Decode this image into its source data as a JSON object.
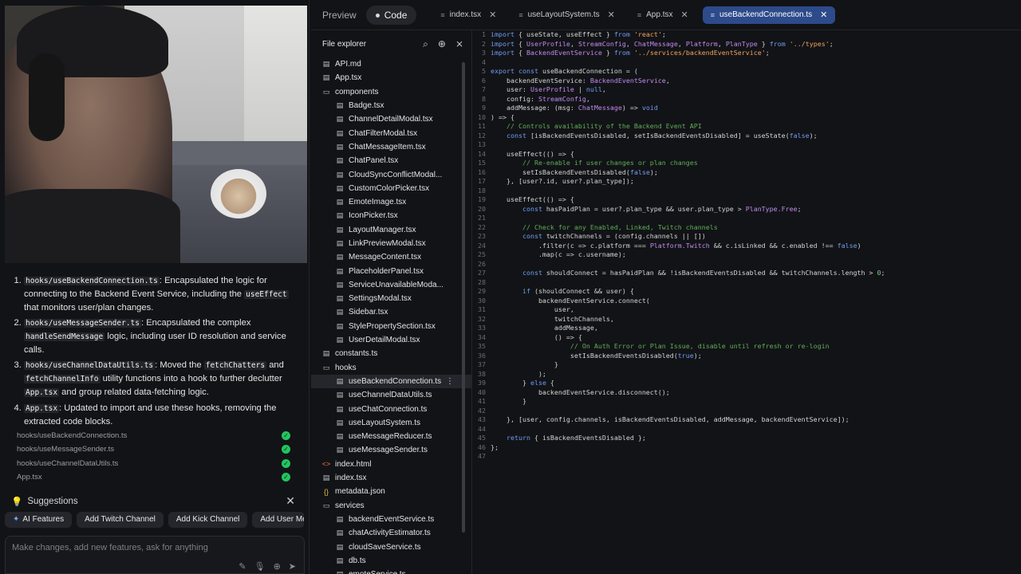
{
  "tabbar": {
    "preview_label": "Preview",
    "code_label": "Code",
    "tabs": [
      {
        "label": "index.tsx",
        "icon": "ts-file-icon",
        "active": false
      },
      {
        "label": "useLayoutSystem.ts",
        "icon": "ts-file-icon",
        "active": false
      },
      {
        "label": "App.tsx",
        "icon": "ts-file-icon",
        "active": false
      },
      {
        "label": "useBackendConnection.ts",
        "icon": "ts-file-icon",
        "active": true
      }
    ]
  },
  "chat": {
    "summary_items": [
      {
        "code": "hooks/useBackendConnection.ts",
        "text_a": ": Encapsulated the logic for connecting to the Backend Event Service, including the ",
        "code2": "useEffect",
        "text_b": " that monitors user/plan changes."
      },
      {
        "code": "hooks/useMessageSender.ts",
        "text_a": ": Encapsulated the complex ",
        "code2": "handleSendMessage",
        "text_b": " logic, including user ID resolution and service calls."
      },
      {
        "code": "hooks/useChannelDataUtils.ts",
        "text_a": ": Moved the ",
        "code2": "fetchChatters",
        "text_b": " and ",
        "code3": "fetchChannelInfo",
        "text_c": " utility functions into a hook to further declutter ",
        "code4": "App.tsx",
        "text_d": " and group related data-fetching logic."
      },
      {
        "code": "App.tsx",
        "text_a": ": Updated to import and use these hooks, removing the extracted code blocks."
      }
    ],
    "files_changed": [
      "hooks/useBackendConnection.ts",
      "hooks/useMessageSender.ts",
      "hooks/useChannelDataUtils.ts",
      "App.tsx"
    ],
    "suggestions_title": "Suggestions",
    "suggestions": [
      "AI Features",
      "Add Twitch Channel",
      "Add Kick Channel",
      "Add User Men"
    ],
    "prompt_placeholder": "Make changes, add new features, ask for anything"
  },
  "explorer": {
    "title": "File explorer",
    "items": [
      {
        "label": "API.md",
        "type": "file",
        "depth": 0
      },
      {
        "label": "App.tsx",
        "type": "file",
        "depth": 0
      },
      {
        "label": "components",
        "type": "folder",
        "depth": 0
      },
      {
        "label": "Badge.tsx",
        "type": "file",
        "depth": 1
      },
      {
        "label": "ChannelDetailModal.tsx",
        "type": "file",
        "depth": 1
      },
      {
        "label": "ChatFilterModal.tsx",
        "type": "file",
        "depth": 1
      },
      {
        "label": "ChatMessageItem.tsx",
        "type": "file",
        "depth": 1
      },
      {
        "label": "ChatPanel.tsx",
        "type": "file",
        "depth": 1
      },
      {
        "label": "CloudSyncConflictModal...",
        "type": "file",
        "depth": 1
      },
      {
        "label": "CustomColorPicker.tsx",
        "type": "file",
        "depth": 1
      },
      {
        "label": "EmoteImage.tsx",
        "type": "file",
        "depth": 1
      },
      {
        "label": "IconPicker.tsx",
        "type": "file",
        "depth": 1
      },
      {
        "label": "LayoutManager.tsx",
        "type": "file",
        "depth": 1
      },
      {
        "label": "LinkPreviewModal.tsx",
        "type": "file",
        "depth": 1
      },
      {
        "label": "MessageContent.tsx",
        "type": "file",
        "depth": 1
      },
      {
        "label": "PlaceholderPanel.tsx",
        "type": "file",
        "depth": 1
      },
      {
        "label": "ServiceUnavailableModa...",
        "type": "file",
        "depth": 1
      },
      {
        "label": "SettingsModal.tsx",
        "type": "file",
        "depth": 1
      },
      {
        "label": "Sidebar.tsx",
        "type": "file",
        "depth": 1
      },
      {
        "label": "StylePropertySection.tsx",
        "type": "file",
        "depth": 1
      },
      {
        "label": "UserDetailModal.tsx",
        "type": "file",
        "depth": 1
      },
      {
        "label": "constants.ts",
        "type": "file",
        "depth": 0
      },
      {
        "label": "hooks",
        "type": "folder",
        "depth": 0
      },
      {
        "label": "useBackendConnection.ts",
        "type": "file",
        "depth": 1,
        "selected": true
      },
      {
        "label": "useChannelDataUtils.ts",
        "type": "file",
        "depth": 1
      },
      {
        "label": "useChatConnection.ts",
        "type": "file",
        "depth": 1
      },
      {
        "label": "useLayoutSystem.ts",
        "type": "file",
        "depth": 1
      },
      {
        "label": "useMessageReducer.ts",
        "type": "file",
        "depth": 1
      },
      {
        "label": "useMessageSender.ts",
        "type": "file",
        "depth": 1
      },
      {
        "label": "index.html",
        "type": "html",
        "depth": 0
      },
      {
        "label": "index.tsx",
        "type": "file",
        "depth": 0
      },
      {
        "label": "metadata.json",
        "type": "json",
        "depth": 0
      },
      {
        "label": "services",
        "type": "folder",
        "depth": 0
      },
      {
        "label": "backendEventService.ts",
        "type": "file",
        "depth": 1
      },
      {
        "label": "chatActivityEstimator.ts",
        "type": "file",
        "depth": 1
      },
      {
        "label": "cloudSaveService.ts",
        "type": "file",
        "depth": 1
      },
      {
        "label": "db.ts",
        "type": "file",
        "depth": 1
      },
      {
        "label": "emoteService.ts",
        "type": "file",
        "depth": 1
      }
    ]
  },
  "code_lines": [
    [
      [
        "kw",
        "import"
      ],
      [
        "ct",
        " { useState, useEffect } "
      ],
      [
        "kw",
        "from"
      ],
      [
        "ct",
        " "
      ],
      [
        "str",
        "'react'"
      ],
      [
        "ct",
        ";"
      ]
    ],
    [
      [
        "kw",
        "import"
      ],
      [
        "ct",
        " { "
      ],
      [
        "ty",
        "UserProfile"
      ],
      [
        "ct",
        ", "
      ],
      [
        "ty",
        "StreamConfig"
      ],
      [
        "ct",
        ", "
      ],
      [
        "ty",
        "ChatMessage"
      ],
      [
        "ct",
        ", "
      ],
      [
        "ty",
        "Platform"
      ],
      [
        "ct",
        ", "
      ],
      [
        "ty",
        "PlanType"
      ],
      [
        "ct",
        " } "
      ],
      [
        "kw",
        "from"
      ],
      [
        "ct",
        " "
      ],
      [
        "str",
        "'../types'"
      ],
      [
        "ct",
        ";"
      ]
    ],
    [
      [
        "kw",
        "import"
      ],
      [
        "ct",
        " { "
      ],
      [
        "ty",
        "BackendEventService"
      ],
      [
        "ct",
        " } "
      ],
      [
        "kw",
        "from"
      ],
      [
        "ct",
        " "
      ],
      [
        "str",
        "'../services/backendEventService'"
      ],
      [
        "ct",
        ";"
      ]
    ],
    [],
    [
      [
        "kw",
        "export const"
      ],
      [
        "ct",
        " useBackendConnection = ("
      ]
    ],
    [
      [
        "ct",
        "    backendEventService: "
      ],
      [
        "ty",
        "BackendEventService"
      ],
      [
        "ct",
        ","
      ]
    ],
    [
      [
        "ct",
        "    user: "
      ],
      [
        "ty",
        "UserProfile"
      ],
      [
        "ct",
        " | "
      ],
      [
        "kw",
        "null"
      ],
      [
        "ct",
        ","
      ]
    ],
    [
      [
        "ct",
        "    config: "
      ],
      [
        "ty",
        "StreamConfig"
      ],
      [
        "ct",
        ","
      ]
    ],
    [
      [
        "ct",
        "    addMessage: (msg: "
      ],
      [
        "ty",
        "ChatMessage"
      ],
      [
        "ct",
        ") => "
      ],
      [
        "kw",
        "void"
      ]
    ],
    [
      [
        "ct",
        ") => {"
      ]
    ],
    [
      [
        "cm",
        "    // Controls availability of the Backend Event API"
      ]
    ],
    [
      [
        "kw",
        "    const"
      ],
      [
        "ct",
        " [isBackendEventsDisabled, setIsBackendEventsDisabled] = useState("
      ],
      [
        "kw",
        "false"
      ],
      [
        "ct",
        ");"
      ]
    ],
    [],
    [
      [
        "ct",
        "    useEffect(() => {"
      ]
    ],
    [
      [
        "cm",
        "        // Re-enable if user changes or plan changes"
      ]
    ],
    [
      [
        "ct",
        "        setIsBackendEventsDisabled("
      ],
      [
        "kw",
        "false"
      ],
      [
        "ct",
        ");"
      ]
    ],
    [
      [
        "ct",
        "    }, [user?.id, user?.plan_type]);"
      ]
    ],
    [],
    [
      [
        "ct",
        "    useEffect(() => {"
      ]
    ],
    [
      [
        "kw",
        "        const"
      ],
      [
        "ct",
        " hasPaidPlan = user?.plan_type && user.plan_type > "
      ],
      [
        "ty",
        "PlanType.Free"
      ],
      [
        "ct",
        ";"
      ]
    ],
    [],
    [
      [
        "cm",
        "        // Check for any Enabled, Linked, Twitch channels"
      ]
    ],
    [
      [
        "kw",
        "        const"
      ],
      [
        "ct",
        " twitchChannels = (config.channels || [])"
      ]
    ],
    [
      [
        "ct",
        "            .filter(c => c.platform === "
      ],
      [
        "ty",
        "Platform.Twitch"
      ],
      [
        "ct",
        " && c.isLinked && c.enabled !== "
      ],
      [
        "kw",
        "false"
      ],
      [
        "ct",
        ")"
      ]
    ],
    [
      [
        "ct",
        "            .map(c => c.username);"
      ]
    ],
    [],
    [
      [
        "kw",
        "        const"
      ],
      [
        "ct",
        " shouldConnect = hasPaidPlan && !isBackendEventsDisabled && twitchChannels.length > "
      ],
      [
        "num",
        "0"
      ],
      [
        "ct",
        ";"
      ]
    ],
    [],
    [
      [
        "kw",
        "        if"
      ],
      [
        "ct",
        " (shouldConnect && user) {"
      ]
    ],
    [
      [
        "ct",
        "            backendEventService.connect("
      ]
    ],
    [
      [
        "ct",
        "                user,"
      ]
    ],
    [
      [
        "ct",
        "                twitchChannels,"
      ]
    ],
    [
      [
        "ct",
        "                addMessage,"
      ]
    ],
    [
      [
        "ct",
        "                () => {"
      ]
    ],
    [
      [
        "cm",
        "                    // On Auth Error or Plan Issue, disable until refresh or re-login"
      ]
    ],
    [
      [
        "ct",
        "                    setIsBackendEventsDisabled("
      ],
      [
        "kw",
        "true"
      ],
      [
        "ct",
        ");"
      ]
    ],
    [
      [
        "ct",
        "                }"
      ]
    ],
    [
      [
        "ct",
        "            );"
      ]
    ],
    [
      [
        "ct",
        "        } "
      ],
      [
        "kw",
        "else"
      ],
      [
        "ct",
        " {"
      ]
    ],
    [
      [
        "ct",
        "            backendEventService.disconnect();"
      ]
    ],
    [
      [
        "ct",
        "        }"
      ]
    ],
    [],
    [
      [
        "ct",
        "    }, [user, config.channels, isBackendEventsDisabled, addMessage, backendEventService]);"
      ]
    ],
    [],
    [
      [
        "kw",
        "    return"
      ],
      [
        "ct",
        " { isBackendEventsDisabled };"
      ]
    ],
    [
      [
        "ct",
        "};"
      ]
    ],
    []
  ]
}
